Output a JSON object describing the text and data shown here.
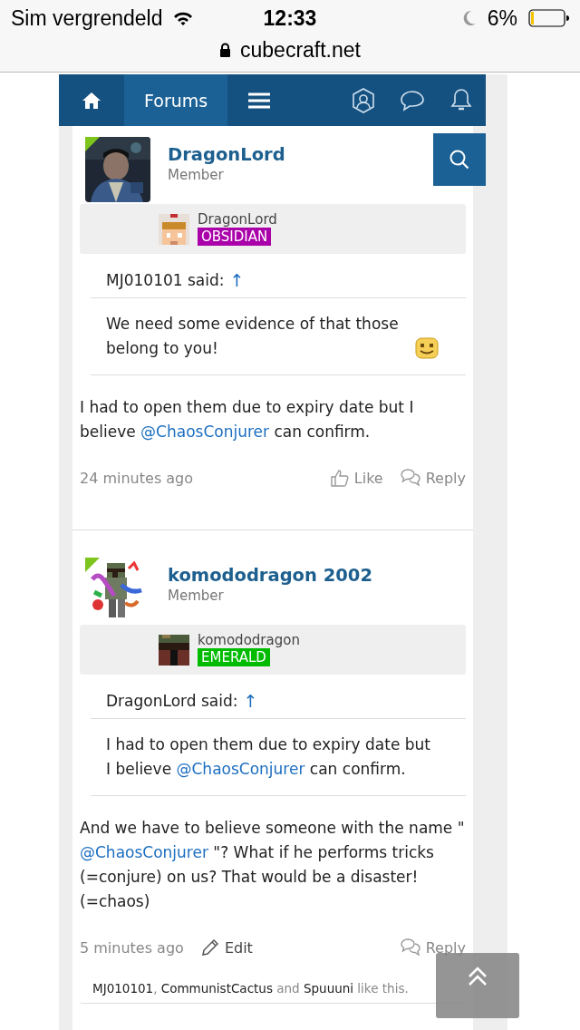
{
  "status_bar": {
    "carrier": "Sim vergrendeld",
    "time": "12:33",
    "battery": "6%"
  },
  "address_bar": {
    "url": "cubecraft.net"
  },
  "nav": {
    "tabs": [
      {
        "label": "Forums",
        "selected": true
      }
    ]
  },
  "posts": [
    {
      "author": "DragonLord",
      "role": "Member",
      "online": true,
      "game_name": "DragonLord",
      "rank": "OBSIDIAN",
      "color": "#aa00aa",
      "quote": {
        "author": "MJ010101 said:",
        "arrow": "↑",
        "parts": [
          {
            "kind": "text",
            "text": "We need some evidence of that those belong to you!"
          }
        ],
        "emoji": true
      },
      "body": [
        {
          "kind": "text",
          "text": "I had to open them due to expiry date but I believe "
        },
        {
          "kind": "mention",
          "text": "@ChaosConjurer"
        },
        {
          "kind": "text",
          "text": " can confirm."
        }
      ],
      "time": "24 minutes ago",
      "actions": [
        {
          "kind": "like",
          "label": "Like"
        },
        {
          "kind": "reply",
          "label": "Reply"
        }
      ]
    },
    {
      "author": "komododragon 2002",
      "role": "Member",
      "online": true,
      "game_name": "komododragon",
      "rank": "EMERALD",
      "color": "#00bb00",
      "quote": {
        "author": "DragonLord said:",
        "arrow": "↑",
        "parts": [
          {
            "kind": "text",
            "text": "I had to open them due to expiry date but I believe "
          },
          {
            "kind": "mention",
            "text": "@ChaosConjurer"
          },
          {
            "kind": "text",
            "text": " can confirm."
          }
        ],
        "emoji": false
      },
      "body": [
        {
          "kind": "text",
          "text": "And we have to believe someone with the name \" "
        },
        {
          "kind": "mention",
          "text": "@ChaosConjurer"
        },
        {
          "kind": "text",
          "text": " \"? What if he performs tricks (=conjure) on us? That would be a disaster! (=chaos)"
        }
      ],
      "time": "5 minutes ago",
      "actions": [
        {
          "kind": "edit",
          "label": "Edit"
        },
        {
          "kind": "reply",
          "label": "Reply"
        }
      ],
      "likes": [
        {
          "kind": "user",
          "text": "MJ010101"
        },
        {
          "kind": "text",
          "text": ", "
        },
        {
          "kind": "user",
          "text": "CommunistCactus"
        },
        {
          "kind": "text",
          "text": " and "
        },
        {
          "kind": "user",
          "text": "Spuuuni"
        },
        {
          "kind": "text",
          "text": " like this."
        }
      ]
    }
  ]
}
